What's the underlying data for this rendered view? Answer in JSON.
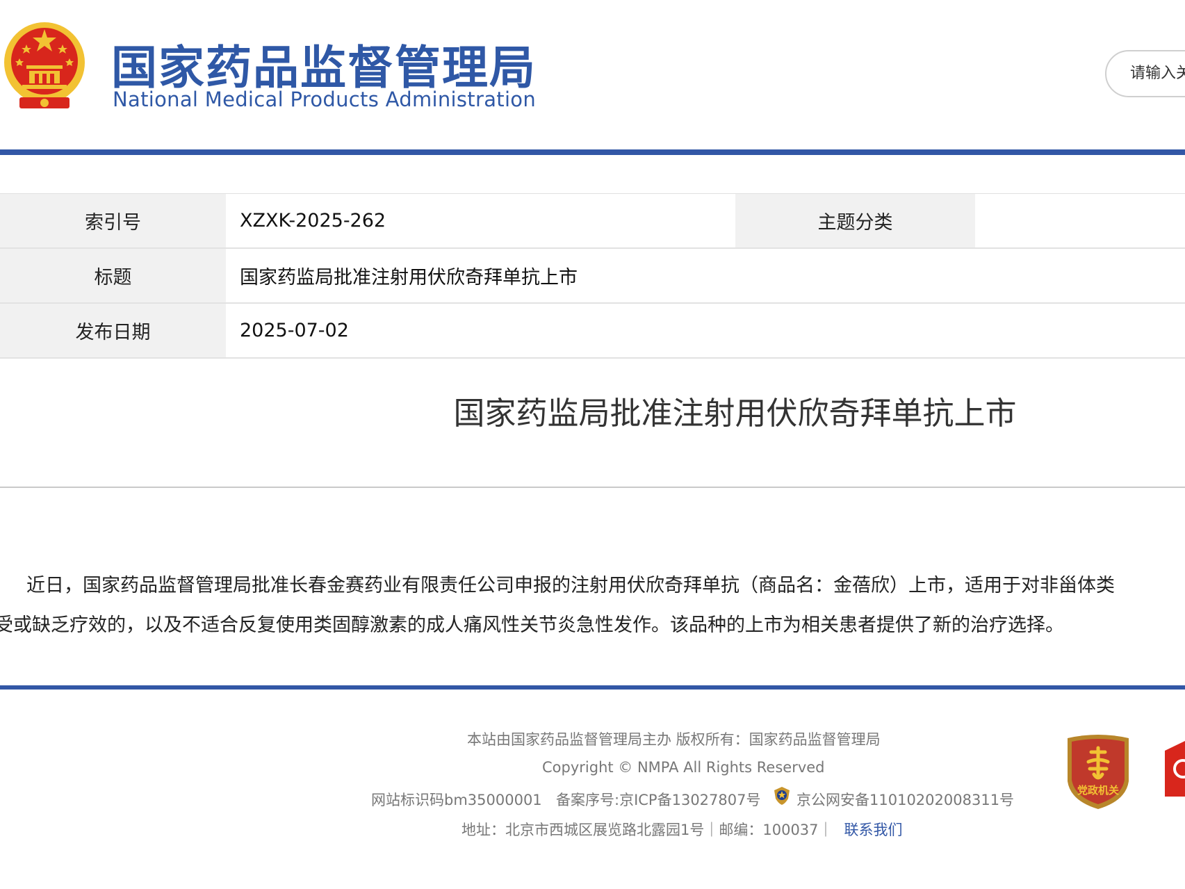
{
  "header": {
    "logo_cn": "国家药品监督管理局",
    "logo_en": "National Medical Products Administration",
    "search_placeholder": "请输入关键词"
  },
  "info_table": {
    "index_label": "索引号",
    "index_value": "XZXK-2025-262",
    "category_label": "主题分类",
    "category_value": "",
    "title_label": "标题",
    "title_value": "国家药监局批准注射用伏欣奇拜单抗上市",
    "date_label": "发布日期",
    "date_value": "2025-07-02"
  },
  "article": {
    "title": "国家药监局批准注射用伏欣奇拜单抗上市",
    "line1": "近日，国家药品监督管理局批准长春金赛药业有限责任公司申报的注射用伏欣奇拜单抗（商品名：金蓓欣）上市，适用于对非甾体类",
    "line2": "受或缺乏疗效的，以及不适合反复使用类固醇激素的成人痛风性关节炎急性发作。该品种的上市为相关患者提供了新的治疗选择。"
  },
  "footer": {
    "sponsor": "本站由国家药品监督管理局主办 版权所有：国家药品监督管理局",
    "copyright": "Copyright © NMPA All Rights Reserved",
    "site_code": "网站标识码bm35000001",
    "icp": "备案序号:京ICP备13027807号",
    "police": "京公网安备11010202008311号",
    "address": "地址：北京市西城区展览路北露园1号｜邮编：100037｜",
    "contact": "联系我们",
    "party_badge_text": "党政机关"
  },
  "colors": {
    "brand_blue": "#3257a6",
    "emblem_red": "#d8261c",
    "emblem_gold": "#f2c233"
  },
  "icons": {
    "emblem": "national-emblem-icon",
    "police": "police-badge-icon",
    "party": "party-government-badge-icon"
  }
}
